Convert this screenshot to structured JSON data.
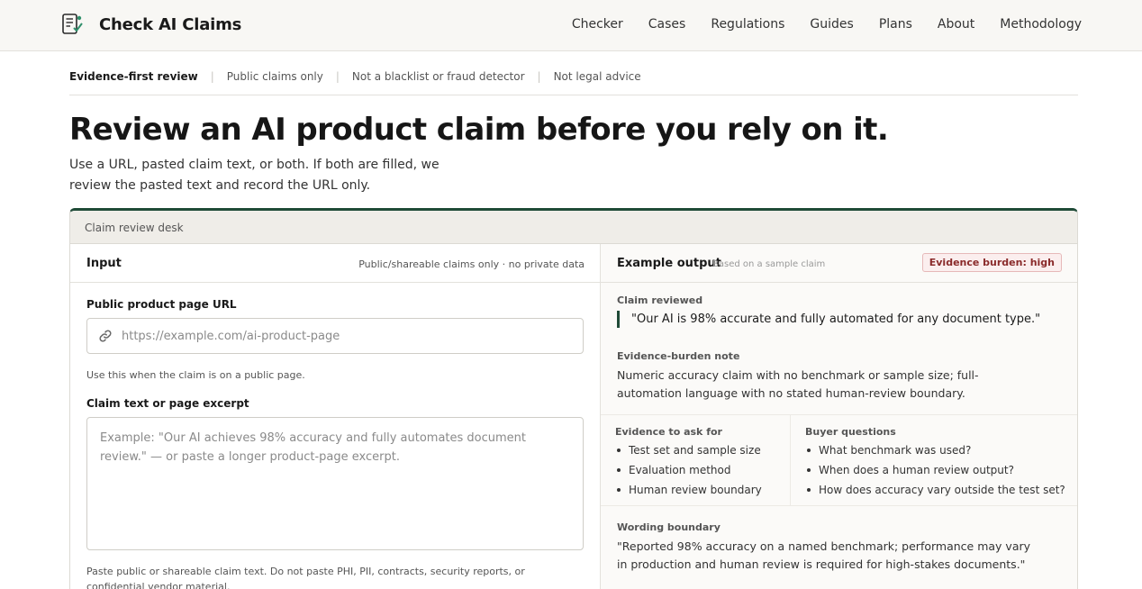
{
  "header": {
    "brand": "Check AI Claims",
    "nav": [
      "Checker",
      "Cases",
      "Regulations",
      "Guides",
      "Plans",
      "About",
      "Methodology"
    ]
  },
  "pills": [
    "Evidence-first review",
    "Public claims only",
    "Not a blacklist or fraud detector",
    "Not legal advice"
  ],
  "hero": {
    "title": "Review an AI product claim before you rely on it.",
    "lede": "Use a URL, pasted claim text, or both. If both are filled, we review the pasted text and record the URL only."
  },
  "desk": {
    "title": "Claim review desk",
    "input": {
      "title": "Input",
      "note": "Public/shareable claims only · no private data",
      "url_label": "Public product page URL",
      "url_placeholder": "https://example.com/ai-product-page",
      "url_hint": "Use this when the claim is on a public page.",
      "text_label": "Claim text or page excerpt",
      "text_placeholder": "Example: \"Our AI achieves 98% accuracy and fully automates document review.\" — or paste a longer product-page excerpt.",
      "text_hint": "Paste public or shareable claim text. Do not paste PHI, PII, contracts, security reports, or confidential vendor material."
    },
    "output": {
      "title": "Example output",
      "subtitle": "Based on a sample claim",
      "badge": "Evidence burden: high",
      "claim_label": "Claim reviewed",
      "claim": "\"Our AI is 98% accurate and fully automated for any document type.\"",
      "note_label": "Evidence-burden note",
      "note": "Numeric accuracy claim with no benchmark or sample size; full-automation language with no stated human-review boundary.",
      "evidence_label": "Evidence to ask for",
      "evidence": [
        "Test set and sample size",
        "Evaluation method",
        "Human review boundary"
      ],
      "questions_label": "Buyer questions",
      "questions": [
        "What benchmark was used?",
        "When does a human review output?",
        "How does accuracy vary outside the test set?"
      ],
      "wording_label": "Wording boundary",
      "wording": "\"Reported 98% accuracy on a named benchmark; performance may vary in production and human review is required for high-stakes documents.\""
    }
  },
  "colors": {
    "accent": "#1f4a37",
    "badge": "#8a2a2a"
  }
}
